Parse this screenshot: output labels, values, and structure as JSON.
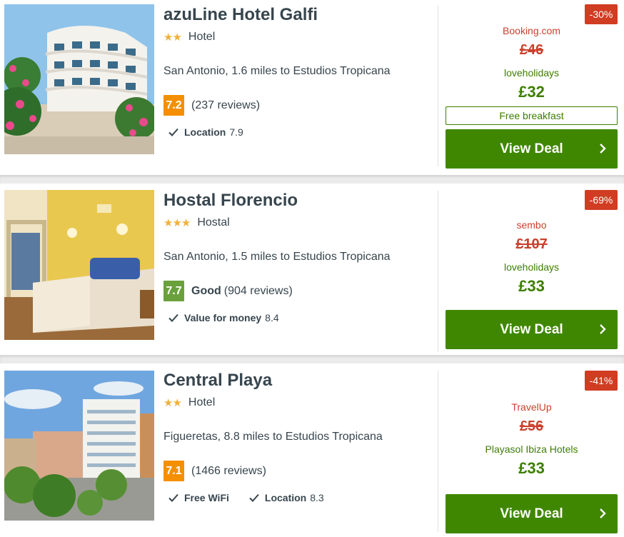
{
  "hotels": [
    {
      "name": "azuLine Hotel Galfi",
      "stars": "★★",
      "type": "Hotel",
      "location": "San Antonio, 1.6 miles to Estudios Tropicana",
      "score": "7.2",
      "score_color": "#f48f00",
      "rating_word": "",
      "reviews": "(237 reviews)",
      "sub_ratings": [
        {
          "label": "Location",
          "value": "7.9"
        }
      ],
      "discount": "-30%",
      "old_provider": "Booking.com",
      "old_price": "£46",
      "provider": "loveholidays",
      "price": "£32",
      "extra": "Free breakfast",
      "cta": "View Deal"
    },
    {
      "name": "Hostal Florencio",
      "stars": "★★★",
      "type": "Hostal",
      "location": "San Antonio, 1.5 miles to Estudios Tropicana",
      "score": "7.7",
      "score_color": "#6aa13c",
      "rating_word": "Good",
      "reviews": "(904 reviews)",
      "sub_ratings": [
        {
          "label": "Value for money",
          "value": "8.4"
        }
      ],
      "discount": "-69%",
      "old_provider": "sembo",
      "old_price": "£107",
      "provider": "loveholidays",
      "price": "£33",
      "extra": "",
      "cta": "View Deal"
    },
    {
      "name": "Central Playa",
      "stars": "★★",
      "type": "Hotel",
      "location": "Figueretas, 8.8 miles to Estudios Tropicana",
      "score": "7.1",
      "score_color": "#f48f00",
      "rating_word": "",
      "reviews": "(1466 reviews)",
      "sub_ratings": [
        {
          "label": "Free WiFi",
          "value": ""
        },
        {
          "label": "Location",
          "value": "8.3"
        }
      ],
      "discount": "-41%",
      "old_provider": "TravelUp",
      "old_price": "£56",
      "provider": "Playasol Ibiza Hotels",
      "price": "£33",
      "extra": "",
      "cta": "View Deal"
    }
  ],
  "colors": {
    "cta_green": "#3f8700",
    "price_green": "#3e7e00",
    "strike_red": "#c9412e",
    "badge_red": "#d03d22",
    "star_gold": "#f0b13e"
  }
}
